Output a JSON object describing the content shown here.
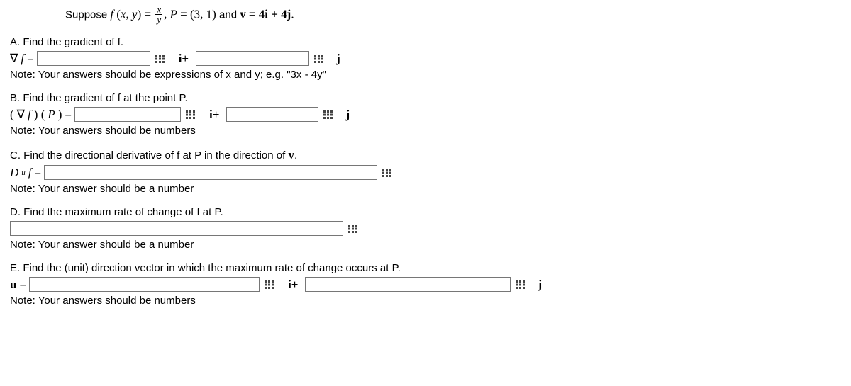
{
  "intro": {
    "prefix": "Suppose ",
    "f": "f",
    "arg_open": " (",
    "x": "x",
    "comma": ", ",
    "y": "y",
    "arg_close": ") ",
    "eq1": "= ",
    "frac_num": "x",
    "frac_den": "y",
    "comma2": ", ",
    "P": "P",
    "eq2": " = ",
    "pval": "(3, 1)",
    "and": " and ",
    "v": "v",
    "eq3": " = ",
    "vval": "4i + 4j",
    "period": "."
  },
  "A": {
    "prompt": "A. Find the gradient of f.",
    "lhs_nabla": "∇",
    "lhs_f": "f",
    "lhs_eq": " = ",
    "mid": "i+",
    "end": "j",
    "note": "Note: Your answers should be expressions of x and y; e.g. \"3x - 4y\""
  },
  "B": {
    "prompt": "B. Find the gradient of f at the point P.",
    "lhs_open": "(",
    "lhs_nabla": "∇",
    "lhs_f": "f",
    "lhs_close": ") (",
    "lhs_P": "P",
    "lhs_close2": ") ",
    "lhs_eq": "= ",
    "mid": "i+",
    "end": "j",
    "note": "Note: Your answers should be numbers"
  },
  "C": {
    "prompt_pre": "C. Find the directional derivative of f at P in the direction of ",
    "prompt_v": "v",
    "prompt_post": ".",
    "lhs_D": "D",
    "lhs_u": "u",
    "lhs_f": "f",
    "lhs_eq": " = ",
    "note": "Note: Your answer should be a number"
  },
  "D": {
    "prompt": "D. Find the maximum rate of change of f at P.",
    "note": "Note: Your answer should be a number"
  },
  "E": {
    "prompt": "E. Find the (unit) direction vector in which the maximum rate of change occurs at P.",
    "lhs_u": "u",
    "lhs_eq": " = ",
    "mid": "i+",
    "end": "j",
    "note": "Note: Your answers should be numbers"
  }
}
